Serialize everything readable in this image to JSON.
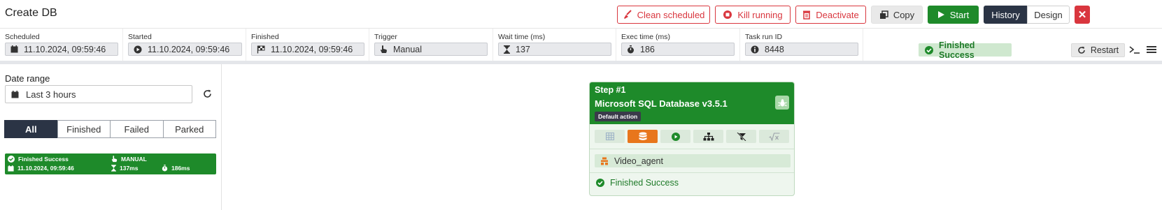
{
  "header": {
    "title": "Create DB",
    "buttons": {
      "clean_scheduled": "Clean scheduled",
      "kill_running": "Kill running",
      "deactivate": "Deactivate",
      "copy": "Copy",
      "start": "Start",
      "history": "History",
      "design": "Design",
      "close": "✕"
    }
  },
  "info": {
    "scheduled": {
      "label": "Scheduled",
      "value": "11.10.2024, 09:59:46"
    },
    "started": {
      "label": "Started",
      "value": "11.10.2024, 09:59:46"
    },
    "finished": {
      "label": "Finished",
      "value": "11.10.2024, 09:59:46"
    },
    "trigger": {
      "label": "Trigger",
      "value": "Manual"
    },
    "wait_time": {
      "label": "Wait time (ms)",
      "value": "137"
    },
    "exec_time": {
      "label": "Exec time (ms)",
      "value": "186"
    },
    "task_run_id": {
      "label": "Task run ID",
      "value": "8448"
    },
    "status": "Finished Success",
    "restart": "Restart"
  },
  "left": {
    "date_range_label": "Date range",
    "date_range_value": "Last 3 hours",
    "tabs": [
      "All",
      "Finished",
      "Failed",
      "Parked"
    ],
    "active_tab": "All",
    "runs": [
      {
        "status": "Finished Success",
        "trigger": "MANUAL",
        "date": "11.10.2024, 09:59:46",
        "wait": "137ms",
        "exec": "186ms"
      }
    ]
  },
  "step": {
    "step_label": "Step #1",
    "title": "Microsoft SQL Database v3.5.1",
    "badge": "Default action",
    "agent": "Video_agent",
    "status": "Finished Success",
    "tools": [
      "table-icon",
      "database-icon",
      "play-icon",
      "hierarchy-icon",
      "filter-off-icon",
      "formula-icon"
    ]
  },
  "colors": {
    "success": "#1e8a2a",
    "danger": "#d9363e",
    "dark": "#2b3445",
    "orange": "#e8761c"
  }
}
